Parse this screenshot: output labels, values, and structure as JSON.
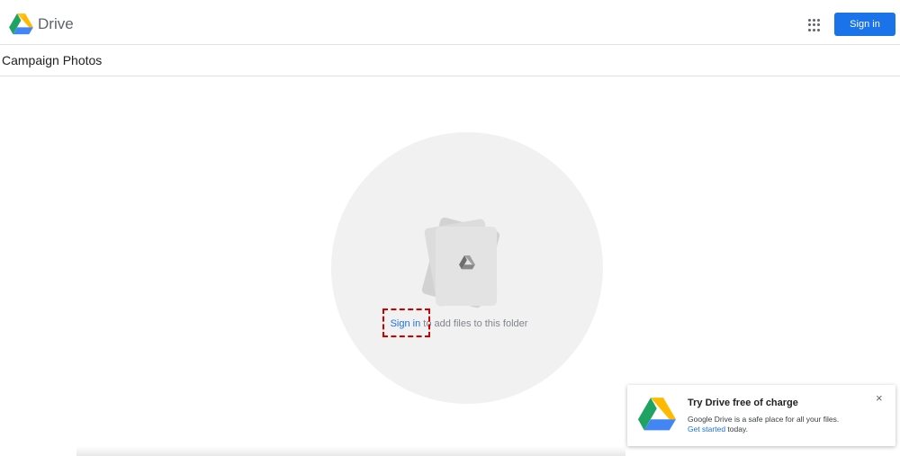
{
  "header": {
    "brand": "Drive",
    "signin_label": "Sign in"
  },
  "folder": {
    "title": "Campaign Photos"
  },
  "empty_state": {
    "link_text": "Sign in",
    "message": " to add files to this folder"
  },
  "promo": {
    "title": "Try Drive free of charge",
    "body": "Google Drive is a safe place for all your files.",
    "link_text": "Get started",
    "link_suffix": " today.",
    "close_glyph": "×"
  },
  "colors": {
    "accent": "#1a73e8",
    "drive_green": "#1ea362",
    "drive_yellow": "#ffba00",
    "drive_blue": "#4285f4",
    "highlight": "#d00000"
  },
  "icons": [
    "drive-logo-icon",
    "apps-grid-icon",
    "close-icon"
  ]
}
